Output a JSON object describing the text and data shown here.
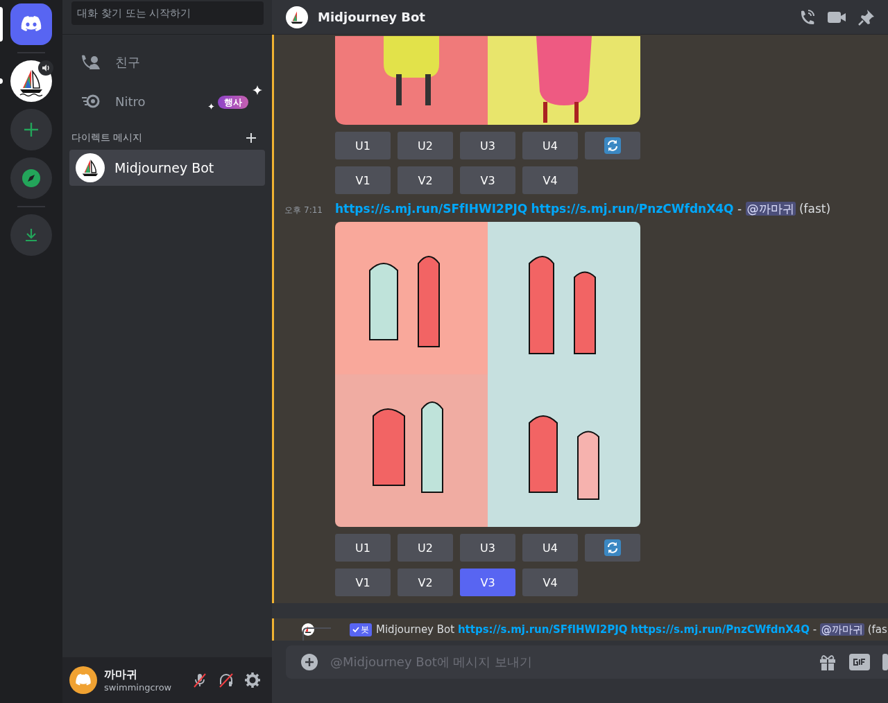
{
  "server_rail": {
    "items": [
      {
        "kind": "home",
        "selected": true
      },
      {
        "kind": "server",
        "selected": false,
        "unread": true
      },
      {
        "kind": "add",
        "selected": false
      },
      {
        "kind": "explore",
        "selected": false
      },
      {
        "kind": "download",
        "selected": false
      }
    ]
  },
  "sidebar": {
    "search": {
      "placeholder": "대화 찾기 또는 시작하기"
    },
    "nav": [
      {
        "kind": "friends",
        "label": "친구"
      },
      {
        "kind": "nitro",
        "label": "Nitro",
        "badge": "행사"
      }
    ],
    "dm_header": "다이렉트 메시지",
    "dms": [
      {
        "name": "Midjourney Bot",
        "selected": true
      }
    ]
  },
  "user": {
    "name": "까마귀",
    "tag": "swimmingcrow",
    "muted": true,
    "deafened": true
  },
  "header": {
    "title": "Midjourney Bot"
  },
  "messages": [
    {
      "image": {
        "kind": "picture"
      },
      "button_rows": [
        [
          {
            "kind": "text",
            "label": "U1",
            "selected": false
          },
          {
            "kind": "text",
            "label": "U2",
            "selected": false
          },
          {
            "kind": "text",
            "label": "U3",
            "selected": false
          },
          {
            "kind": "text",
            "label": "U4",
            "selected": false
          },
          {
            "kind": "refresh",
            "selected": false
          }
        ],
        [
          {
            "kind": "text",
            "label": "V1",
            "selected": false
          },
          {
            "kind": "text",
            "label": "V2",
            "selected": false
          },
          {
            "kind": "text",
            "label": "V3",
            "selected": false
          },
          {
            "kind": "text",
            "label": "V4",
            "selected": false
          }
        ]
      ]
    },
    {
      "time": "오후 7:11",
      "links": [
        "https://s.mj.run/SFfIHWI2PJQ",
        "https://s.mj.run/PnzCWfdnX4Q"
      ],
      "separator": "-",
      "mention": "@까마귀",
      "suffix": "(fast)",
      "image": {
        "kind": "picture"
      },
      "button_rows": [
        [
          {
            "kind": "text",
            "label": "U1",
            "selected": false
          },
          {
            "kind": "text",
            "label": "U2",
            "selected": false
          },
          {
            "kind": "text",
            "label": "U3",
            "selected": false
          },
          {
            "kind": "text",
            "label": "U4",
            "selected": false
          },
          {
            "kind": "refresh",
            "selected": false
          }
        ],
        [
          {
            "kind": "text",
            "label": "V1",
            "selected": false
          },
          {
            "kind": "text",
            "label": "V2",
            "selected": false
          },
          {
            "kind": "text",
            "label": "V3",
            "selected": true
          },
          {
            "kind": "text",
            "label": "V4",
            "selected": false
          }
        ]
      ]
    }
  ],
  "reply_preview": {
    "bot_tag": "봇",
    "author": "Midjourney Bot",
    "links": [
      "https://s.mj.run/SFfIHWI2PJQ",
      "https://s.mj.run/PnzCWfdnX4Q"
    ],
    "separator": "-",
    "mention": "@까마귀",
    "suffix": "(fas"
  },
  "composer": {
    "placeholder": "@Midjourney Bot에 메시지 보내기"
  }
}
